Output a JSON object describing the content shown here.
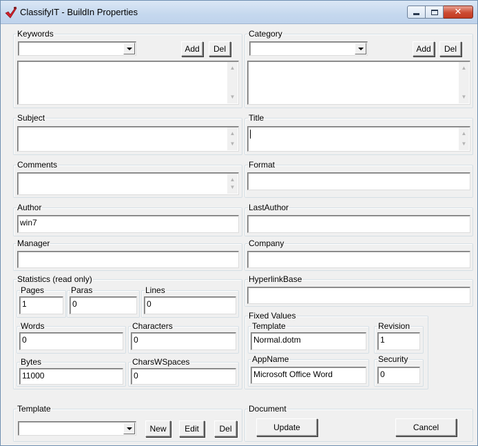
{
  "window": {
    "title": "ClassifyIT - BuildIn Properties",
    "accent": "#c5d8ee",
    "close_color": "#cc4b32"
  },
  "keywords": {
    "legend": "Keywords",
    "selected": "",
    "add_label": "Add",
    "del_label": "Del",
    "list_text": ""
  },
  "category": {
    "legend": "Category",
    "selected": "",
    "add_label": "Add",
    "del_label": "Del",
    "list_text": ""
  },
  "subject": {
    "legend": "Subject",
    "value": ""
  },
  "title": {
    "legend": "Title",
    "value": ""
  },
  "comments": {
    "legend": "Comments",
    "value": ""
  },
  "format": {
    "legend": "Format",
    "value": ""
  },
  "author": {
    "legend": "Author",
    "value": "win7"
  },
  "last_author": {
    "legend": "LastAuthor",
    "value": ""
  },
  "manager": {
    "legend": "Manager",
    "value": ""
  },
  "company": {
    "legend": "Company",
    "value": ""
  },
  "hyperlink_base": {
    "legend": "HyperlinkBase",
    "value": ""
  },
  "statistics": {
    "legend": "Statistics (read only)",
    "pages": {
      "label": "Pages",
      "value": "1"
    },
    "paras": {
      "label": "Paras",
      "value": "0"
    },
    "lines": {
      "label": "Lines",
      "value": "0"
    },
    "words": {
      "label": "Words",
      "value": "0"
    },
    "characters": {
      "label": "Characters",
      "value": "0"
    },
    "bytes": {
      "label": "Bytes",
      "value": "11000"
    },
    "chars_w_spaces": {
      "label": "CharsWSpaces",
      "value": "0"
    }
  },
  "fixed_values": {
    "legend": "Fixed Values",
    "template": {
      "label": "Template",
      "value": "Normal.dotm"
    },
    "revision": {
      "label": "Revision",
      "value": "1"
    },
    "app_name": {
      "label": "AppName",
      "value": "Microsoft Office Word"
    },
    "security": {
      "label": "Security",
      "value": "0"
    }
  },
  "template_section": {
    "legend": "Template",
    "selected": "",
    "new_label": "New",
    "edit_label": "Edit",
    "del_label": "Del"
  },
  "document_section": {
    "legend": "Document",
    "update_label": "Update",
    "cancel_label": "Cancel"
  },
  "icons": {
    "app": "classify-check-icon",
    "minimize": "minimize-icon",
    "maximize": "maximize-icon",
    "close": "close-icon",
    "dropdown": "chevron-down-icon",
    "scroll_up": "scroll-up-icon",
    "scroll_down": "scroll-down-icon"
  }
}
